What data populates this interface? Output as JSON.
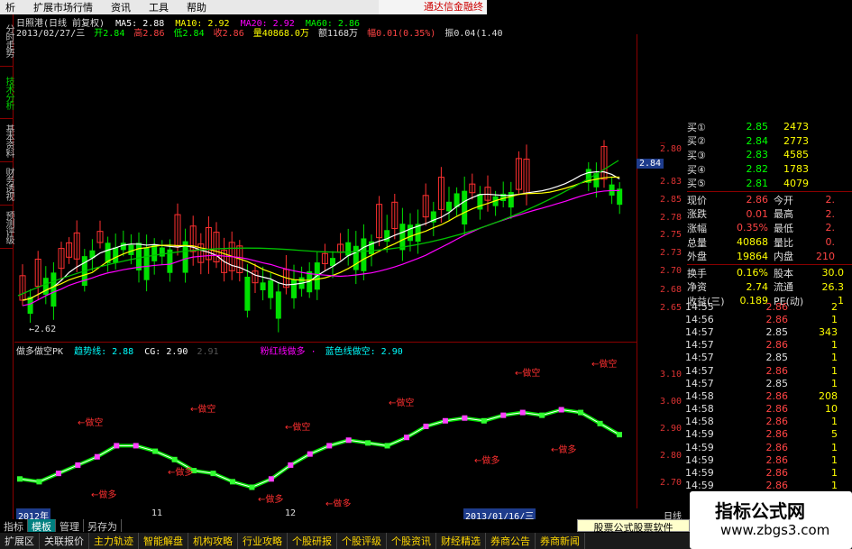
{
  "menu": [
    "析",
    "扩展市场行情",
    "资讯",
    "工具",
    "帮助"
  ],
  "brand": "通达信金融终",
  "left_tabs": [
    "分时走势",
    "技术分析",
    "基本资料",
    "财务透视",
    "预测评级"
  ],
  "header": {
    "title": "日照港(日线 前复权)",
    "ma5": "MA5: 2.88",
    "ma10": "MA10: 2.92",
    "ma20": "MA20: 2.92",
    "ma60": "MA60: 2.86",
    "date": "2013/02/27/三",
    "open": "开2.84",
    "high": "高2.86",
    "low": "低2.84",
    "close": "收2.86",
    "vol": "量40868.0万",
    "amt": "额1168万",
    "chg": "幅0.01(0.35%)",
    "turn": "振0.04(1.40"
  },
  "price_axis": [
    "2.80",
    "2.75",
    "2.70",
    "2.65",
    "2.85",
    "2.83",
    "2.78",
    "2.73",
    "2.68"
  ],
  "price_axis_visible": [
    "2.80",
    "2.75",
    "2.70",
    "2.65"
  ],
  "current_price_tag": "2.84",
  "low_marker": "←2.62",
  "indicator": {
    "name": "做多做空PK",
    "trend": "趋势线: 2.88",
    "cg": "CG: 2.90",
    "extra": "2.91",
    "red_line": "粉红线做多 ·",
    "blue_line": "蓝色线做空: 2.90",
    "axis": [
      "3.10",
      "3.00",
      "2.90",
      "2.80",
      "2.70"
    ],
    "sell_label": "做空",
    "buy_label": "做多"
  },
  "chart_data": {
    "type": "line",
    "title": "",
    "note": "indicator line",
    "series": [
      {
        "values": [
          2.72,
          2.71,
          2.74,
          2.77,
          2.8,
          2.84,
          2.84,
          2.82,
          2.79,
          2.75,
          2.74,
          2.71,
          2.69,
          2.72,
          2.77,
          2.81,
          2.84,
          2.86,
          2.85,
          2.84,
          2.87,
          2.91,
          2.93,
          2.94,
          2.93,
          2.95,
          2.96,
          2.95,
          2.97,
          2.96,
          2.92,
          2.88
        ]
      }
    ]
  },
  "quote": {
    "bids": [
      {
        "label": "买①",
        "price": "2.85",
        "vol": "2473"
      },
      {
        "label": "买②",
        "price": "2.84",
        "vol": "2773"
      },
      {
        "label": "买③",
        "price": "2.83",
        "vol": "4585"
      },
      {
        "label": "买④",
        "price": "2.82",
        "vol": "1783"
      },
      {
        "label": "买⑤",
        "price": "2.81",
        "vol": "4079"
      }
    ],
    "stats": [
      {
        "l1": "现价",
        "v1": "2.86",
        "l2": "今开",
        "v2": "2."
      },
      {
        "l1": "涨跌",
        "v1": "0.01",
        "l2": "最高",
        "v2": "2."
      },
      {
        "l1": "涨幅",
        "v1": "0.35%",
        "l2": "最低",
        "v2": "2."
      },
      {
        "l1": "总量",
        "v1": "40868",
        "l2": "量比",
        "v2": "0."
      },
      {
        "l1": "外盘",
        "v1": "19864",
        "l2": "内盘",
        "v2": "210"
      }
    ],
    "stats2": [
      {
        "l1": "换手",
        "v1": "0.16%",
        "l2": "股本",
        "v2": "30.0"
      },
      {
        "l1": "净资",
        "v1": "2.74",
        "l2": "流通",
        "v2": "26.3"
      },
      {
        "l1": "收益(三)",
        "v1": "0.189",
        "l2": "PE(动)",
        "v2": "1"
      }
    ]
  },
  "ticks": [
    {
      "t": "14:55",
      "p": "2.86",
      "v": "2"
    },
    {
      "t": "14:56",
      "p": "2.86",
      "v": "1"
    },
    {
      "t": "14:57",
      "p": "2.85",
      "v": "343"
    },
    {
      "t": "14:57",
      "p": "2.86",
      "v": "1"
    },
    {
      "t": "14:57",
      "p": "2.85",
      "v": "1"
    },
    {
      "t": "14:57",
      "p": "2.86",
      "v": "1"
    },
    {
      "t": "14:57",
      "p": "2.85",
      "v": "1"
    },
    {
      "t": "14:58",
      "p": "2.86",
      "v": "208"
    },
    {
      "t": "14:58",
      "p": "2.86",
      "v": "10"
    },
    {
      "t": "14:58",
      "p": "2.86",
      "v": "1"
    },
    {
      "t": "14:59",
      "p": "2.86",
      "v": "5"
    },
    {
      "t": "14:59",
      "p": "2.86",
      "v": "1"
    },
    {
      "t": "14:59",
      "p": "2.86",
      "v": "1"
    },
    {
      "t": "14:59",
      "p": "2.86",
      "v": "1"
    },
    {
      "t": "14:59",
      "p": "2.86",
      "v": "1"
    }
  ],
  "datebar": {
    "d1": "2012年",
    "d2": "11",
    "d3": "12",
    "d4": "2013/01/16/三",
    "d5": "日线"
  },
  "bottom_tabs": [
    "指标",
    "模板",
    "管理",
    "另存为"
  ],
  "toolbar": [
    "扩展区",
    "关联报价",
    "主力轨迹",
    "智能解盘",
    "机构攻略",
    "行业攻略",
    "个股研报",
    "个股评级",
    "个股资讯",
    "财经精选",
    "券商公告",
    "券商新闻"
  ],
  "popup": "股票公式股票软件",
  "watermark": {
    "title": "指标公式网",
    "url": "www.zbgs3.com"
  }
}
